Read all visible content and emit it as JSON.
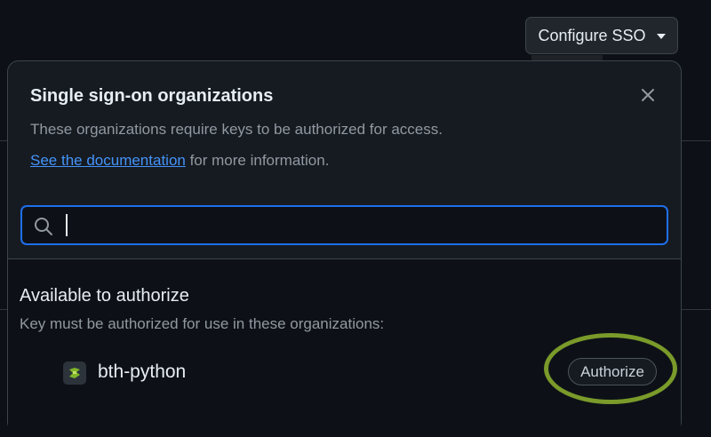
{
  "header": {
    "configure_sso_label": "Configure SSO"
  },
  "dialog": {
    "title": "Single sign-on organizations",
    "description": "These organizations require keys to be authorized for access.",
    "doc_link_label": "See the documentation",
    "doc_suffix": " for more information.",
    "search": {
      "value": "",
      "placeholder": ""
    },
    "section": {
      "heading": "Available to authorize",
      "subheading": "Key must be authorized for use in these organizations:"
    },
    "organizations": [
      {
        "name": "bth-python",
        "action_label": "Authorize"
      }
    ]
  },
  "colors": {
    "background": "#0d1117",
    "dialog_bg": "#161b22",
    "border": "#3d444d",
    "link": "#4493f8",
    "focus": "#1f6feb",
    "highlight_ring": "#7a9a2a"
  },
  "icons": [
    "caret-down-icon",
    "close-icon",
    "search-icon",
    "org-avatar-icon"
  ]
}
